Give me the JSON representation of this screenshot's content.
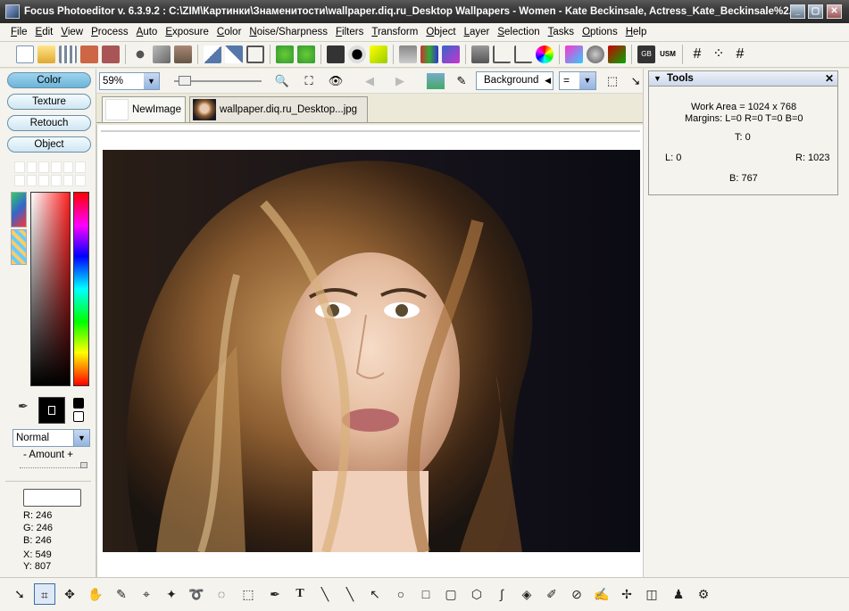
{
  "window": {
    "title": "Focus Photoeditor v. 6.3.9.2 :  C:\\ZIM\\Картинки\\Знаменитости\\wallpaper.diq.ru_Desktop Wallpapers - Women - Kate Beckinsale, Actress_Kate_Beckinsale%2."
  },
  "menu": [
    "File",
    "Edit",
    "View",
    "Process",
    "Auto",
    "Exposure",
    "Color",
    "Noise/Sharpness",
    "Filters",
    "Transform",
    "Object",
    "Layer",
    "Selection",
    "Tasks",
    "Options",
    "Help"
  ],
  "left_panel": {
    "modes": [
      "Color",
      "Texture",
      "Retouch",
      "Object"
    ],
    "active_mode": "Color",
    "blend_mode": "Normal",
    "amount_label": "- Amount +",
    "pixel_info": {
      "r": "R: 246",
      "g": "G: 246",
      "b": "B: 246",
      "x": "X: 549",
      "y": "Y: 807"
    }
  },
  "toolbar2": {
    "zoom": "59%",
    "layer_select": "Background",
    "compare_select": "="
  },
  "tabs": [
    {
      "label": "NewImage"
    },
    {
      "label": "wallpaper.diq.ru_Desktop...jpg"
    }
  ],
  "tools_panel": {
    "title": "Tools",
    "work_area": "Work Area = 1024 x 768",
    "margins": "Margins: L=0 R=0 T=0 B=0",
    "t": "T: 0",
    "l": "L: 0",
    "r": "R: 1023",
    "b": "B: 767"
  },
  "colors": {
    "accent": "#6cb4d8",
    "titlebar": "#3a3a3a"
  },
  "icons": {
    "toolbar1": [
      "new-icon",
      "open-icon",
      "browse-icon",
      "save-icon",
      "save-as-icon",
      "cut-icon",
      "copy-icon",
      "paste-icon",
      "mirror-icon",
      "flip-icon",
      "crop-icon",
      "auto-fix-icon",
      "auto-fix2-icon",
      "screenshot-icon",
      "histogram-icon",
      "dropdown-icon",
      "enhance-icon",
      "dropdown-icon",
      "print-icon",
      "balance-icon",
      "channels-icon",
      "resize-icon",
      "curve-icon",
      "level-icon",
      "color-wheel-icon",
      "hue-icon",
      "palette-icon",
      "replace-color-icon",
      "gb-icon",
      "usm-icon",
      "grid-icon",
      "grid2-icon",
      "grid3-icon"
    ],
    "bottom": [
      "arrow-tool-icon",
      "crop-tool-icon",
      "move-tool-icon",
      "hand-tool-icon",
      "brush-tool-icon",
      "magic-select-icon",
      "magic-wand-icon",
      "lasso-icon",
      "freehand-select-icon",
      "rect-select-icon",
      "eyedropper-icon",
      "text-tool-icon",
      "pen-tool-icon",
      "line-tool-icon",
      "arrow-line-icon",
      "ellipse-tool-icon",
      "rect-tool-icon",
      "rounded-rect-icon",
      "hexagon-icon",
      "curve-tool-icon",
      "fill-tool-icon",
      "color-replace-icon",
      "clone-icon",
      "paint-icon",
      "retouch-icon",
      "eraser-icon",
      "stamp-icon",
      "effects-icon"
    ]
  }
}
